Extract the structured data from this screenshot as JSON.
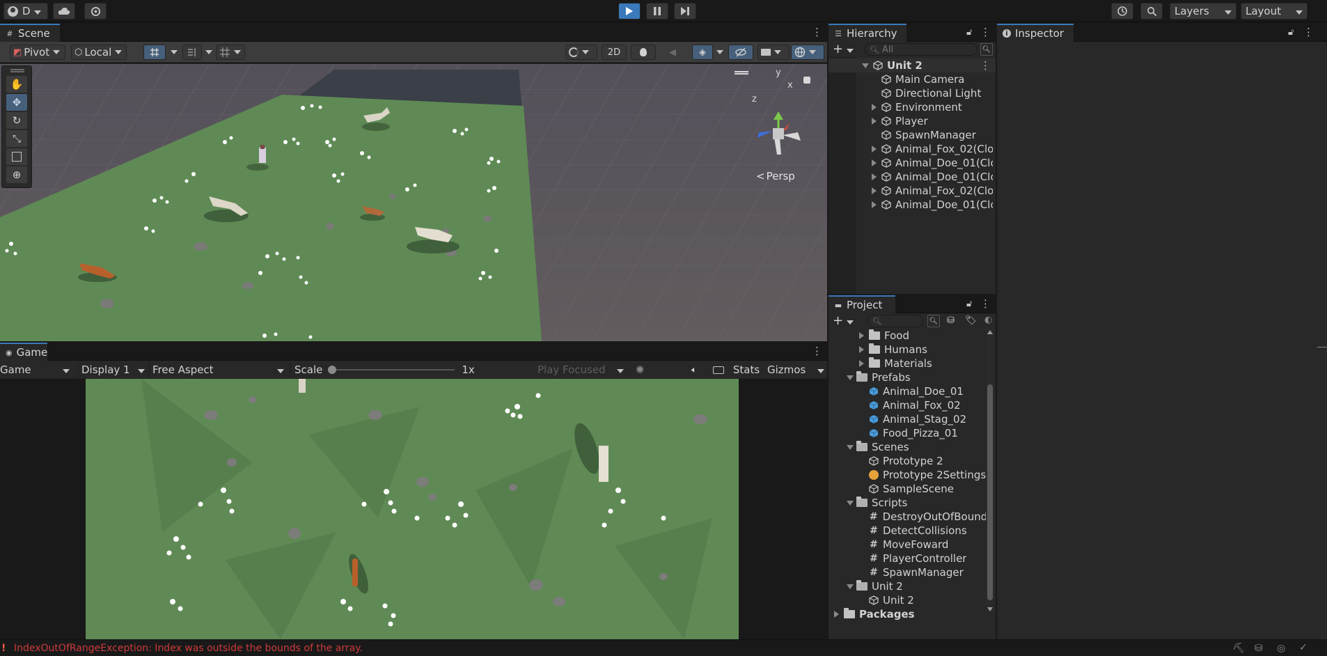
{
  "toolbar": {
    "account_label": "D",
    "layers_label": "Layers",
    "layout_label": "Layout"
  },
  "scene": {
    "tab_label": "Scene",
    "pivot_label": "Pivot",
    "local_label": "Local",
    "twod_label": "2D",
    "persp_label": "Persp",
    "gizmo_y": "y",
    "gizmo_x": "x",
    "gizmo_z": "z"
  },
  "game": {
    "tab_label": "Game",
    "mode_label": "Game",
    "display_label": "Display 1",
    "aspect_label": "Free Aspect",
    "scale_label": "Scale",
    "scale_value": "1x",
    "play_focused_label": "Play Focused",
    "stats_label": "Stats",
    "gizmos_label": "Gizmos"
  },
  "hierarchy": {
    "tab_label": "Hierarchy",
    "search_placeholder": "All",
    "root": "Unit 2",
    "items": [
      {
        "label": "Main Camera",
        "expandable": false
      },
      {
        "label": "Directional Light",
        "expandable": false
      },
      {
        "label": "Environment",
        "expandable": true
      },
      {
        "label": "Player",
        "expandable": true
      },
      {
        "label": "SpawnManager",
        "expandable": false
      },
      {
        "label": "Animal_Fox_02(Clon",
        "expandable": true
      },
      {
        "label": "Animal_Doe_01(Clo",
        "expandable": true
      },
      {
        "label": "Animal_Doe_01(Clo",
        "expandable": true
      },
      {
        "label": "Animal_Fox_02(Clon",
        "expandable": true
      },
      {
        "label": "Animal_Doe_01(Clo",
        "expandable": true
      }
    ]
  },
  "inspector": {
    "tab_label": "Inspector"
  },
  "project": {
    "tab_label": "Project",
    "tree": [
      {
        "label": "Food",
        "kind": "folder",
        "indent": 2,
        "state": "collapsed"
      },
      {
        "label": "Humans",
        "kind": "folder",
        "indent": 2,
        "state": "collapsed"
      },
      {
        "label": "Materials",
        "kind": "folder",
        "indent": 2,
        "state": "collapsed"
      },
      {
        "label": "Prefabs",
        "kind": "folder",
        "indent": 1,
        "state": "open"
      },
      {
        "label": "Animal_Doe_01",
        "kind": "prefab",
        "indent": 2,
        "state": "none"
      },
      {
        "label": "Animal_Fox_02",
        "kind": "prefab",
        "indent": 2,
        "state": "none"
      },
      {
        "label": "Animal_Stag_02",
        "kind": "prefab",
        "indent": 2,
        "state": "none"
      },
      {
        "label": "Food_Pizza_01",
        "kind": "prefab",
        "indent": 2,
        "state": "none"
      },
      {
        "label": "Scenes",
        "kind": "folder",
        "indent": 1,
        "state": "open"
      },
      {
        "label": "Prototype 2",
        "kind": "scene",
        "indent": 2,
        "state": "none"
      },
      {
        "label": "Prototype 2Settings",
        "kind": "settings",
        "indent": 2,
        "state": "none"
      },
      {
        "label": "SampleScene",
        "kind": "scene",
        "indent": 2,
        "state": "none"
      },
      {
        "label": "Scripts",
        "kind": "folder",
        "indent": 1,
        "state": "open"
      },
      {
        "label": "DestroyOutOfBound",
        "kind": "script",
        "indent": 2,
        "state": "none"
      },
      {
        "label": "DetectCollisions",
        "kind": "script",
        "indent": 2,
        "state": "none"
      },
      {
        "label": "MoveFoward",
        "kind": "script",
        "indent": 2,
        "state": "none"
      },
      {
        "label": "PlayerController",
        "kind": "script",
        "indent": 2,
        "state": "none"
      },
      {
        "label": "SpawnManager",
        "kind": "script",
        "indent": 2,
        "state": "none"
      },
      {
        "label": "Unit 2",
        "kind": "folder",
        "indent": 1,
        "state": "open"
      },
      {
        "label": "Unit 2",
        "kind": "scene",
        "indent": 2,
        "state": "none"
      },
      {
        "label": "Packages",
        "kind": "folder",
        "indent": 0,
        "state": "collapsed",
        "bold": true
      }
    ]
  },
  "status": {
    "message": "IndexOutOfRangeException: Index was outside the bounds of the array."
  },
  "colors": {
    "accent": "#3a79bb",
    "grass": "#5f8a55",
    "error": "#cc3b3b"
  }
}
